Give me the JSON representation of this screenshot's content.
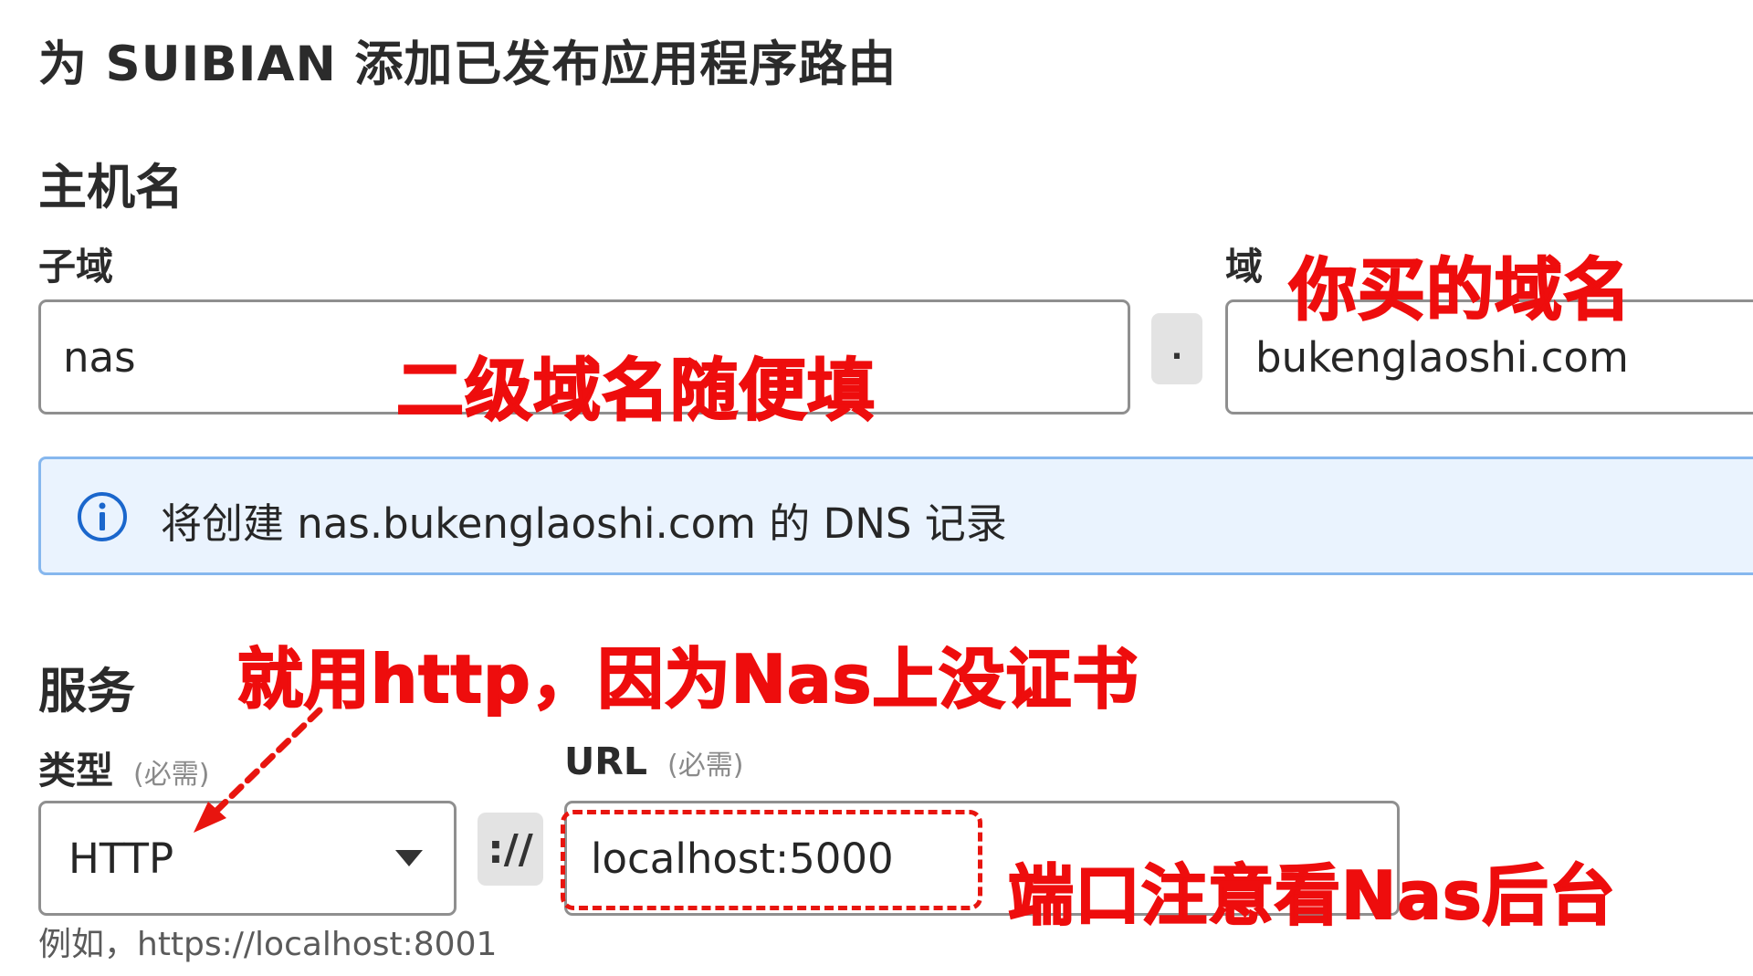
{
  "page": {
    "title": "为 SUIBIAN 添加已发布应用程序路由"
  },
  "hostname": {
    "section_title": "主机名",
    "subdomain_label": "子域",
    "subdomain_value": "nas",
    "dot_separator": ".",
    "domain_label": "域",
    "domain_value": "bukenglaoshi.com"
  },
  "info": {
    "icon": "info-circle-icon",
    "text": "将创建 nas.bukenglaoshi.com 的 DNS 记录"
  },
  "service": {
    "section_title": "服务",
    "type_label": "类型",
    "type_required": "(必需)",
    "type_value": "HTTP",
    "scheme_separator": "://",
    "url_label": "URL",
    "url_required": "(必需)",
    "url_value": "localhost:5000",
    "hint": "例如，https://localhost:8001"
  },
  "annotations": {
    "domain_note": "你买的域名",
    "subdomain_note": "二级域名随便填",
    "type_note": "就用http，因为Nas上没证书",
    "port_note": "端口注意看Nas后台"
  },
  "colors": {
    "annotation_red": "#ee0d0d",
    "info_bg": "#eaf3fe",
    "info_border": "#86b7ee",
    "info_icon": "#1a66cc"
  }
}
